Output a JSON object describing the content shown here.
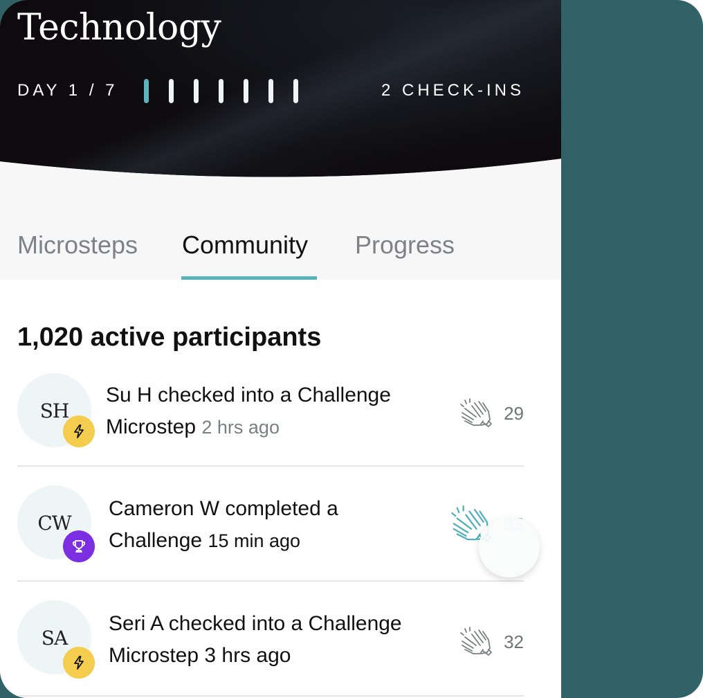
{
  "header": {
    "title": "Technology",
    "day_label": "DAY 1 / 7",
    "progress": {
      "current_day": 1,
      "total_days": 7
    },
    "checkins": "2 CHECK-INS"
  },
  "tabs": [
    {
      "label": "Microsteps",
      "active": false
    },
    {
      "label": "Community",
      "active": true
    },
    {
      "label": "Progress",
      "active": false
    }
  ],
  "community": {
    "participants": "1,020 active participants",
    "feed": [
      {
        "initials": "SH",
        "badge": "lightning-icon",
        "badge_color": "#f4cd4e",
        "line1": "Su H checked into a Challenge",
        "line2": "Microstep",
        "time": "2 hrs ago",
        "claps": "29",
        "clapped": false
      },
      {
        "initials": "CW",
        "badge": "trophy-icon",
        "badge_color": "#7c2fe0",
        "line1": "Cameron W completed a",
        "line2": "Challenge",
        "time": "15 min ago",
        "claps": "35",
        "clapped": true
      },
      {
        "initials": "SA",
        "badge": "lightning-icon",
        "badge_color": "#f4cd4e",
        "line1": "Seri A checked into a Challenge",
        "line2": "Microstep",
        "time": "3 hrs ago",
        "claps": "32",
        "clapped": false
      }
    ]
  },
  "colors": {
    "accent": "#59b3bd",
    "side_panel": "#316267",
    "clap_active": "#4fb0b9"
  }
}
